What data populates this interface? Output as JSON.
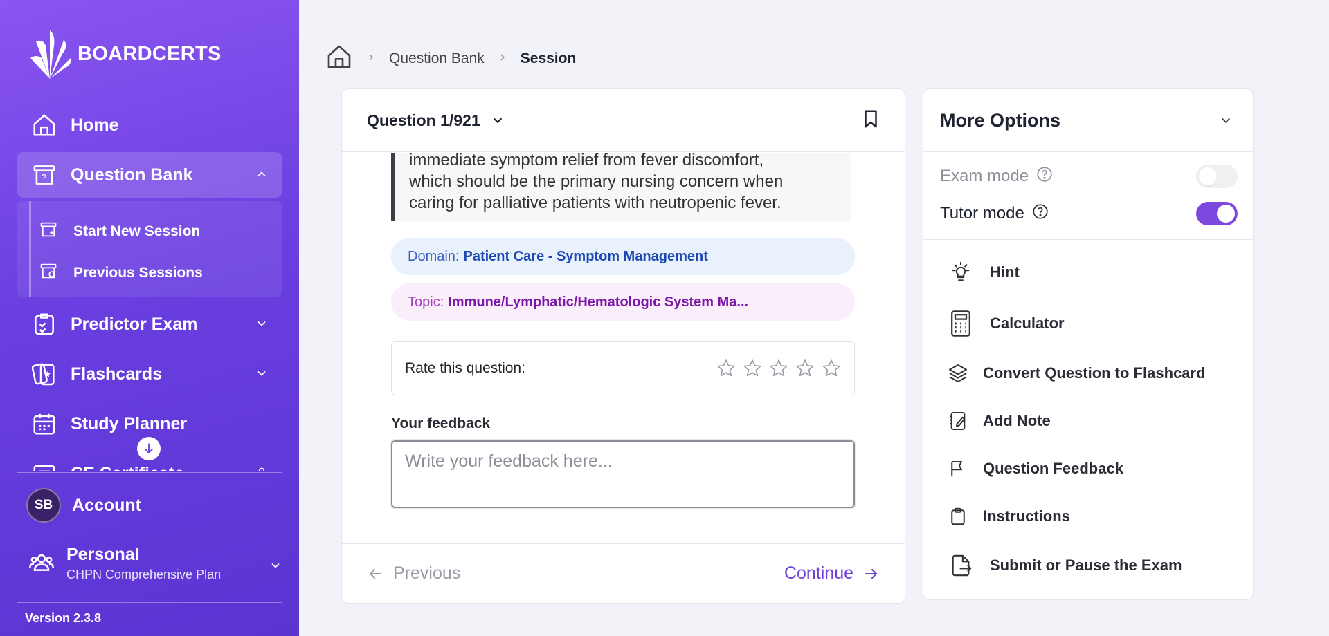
{
  "brand": {
    "name": "BOARDCERTS"
  },
  "sidebar": {
    "items": [
      {
        "label": "Home",
        "icon": "home-icon"
      },
      {
        "label": "Question Bank",
        "icon": "question-box-icon"
      },
      {
        "label": "Predictor Exam",
        "icon": "clipboard-check-icon"
      },
      {
        "label": "Flashcards",
        "icon": "flashcards-icon"
      },
      {
        "label": "Study Planner",
        "icon": "calendar-icon"
      },
      {
        "label": "CE Certificate",
        "icon": "certificate-icon"
      }
    ],
    "subitems": [
      {
        "label": "Start New Session",
        "icon": "new-session-icon"
      },
      {
        "label": "Previous Sessions",
        "icon": "previous-sessions-icon"
      }
    ],
    "account": {
      "initials": "SB",
      "label": "Account"
    },
    "plan": {
      "title": "Personal",
      "subtitle": "CHPN Comprehensive Plan"
    },
    "version": "Version 2.3.8"
  },
  "breadcrumb": {
    "items": [
      "Question Bank",
      "Session"
    ]
  },
  "question": {
    "counter": "Question 1/921",
    "explanation": [
      "immediate symptom relief from fever discomfort,",
      "which should be the primary nursing concern when",
      "caring for palliative patients with neutropenic fever."
    ],
    "domain": {
      "key": "Domain:",
      "value": "Patient Care - Symptom Management"
    },
    "topic": {
      "key": "Topic:",
      "value": "Immune/Lymphatic/Hematologic System Ma..."
    },
    "rate_label": "Rate this question:",
    "rating": 0,
    "rating_max": 5,
    "feedback_label": "Your feedback",
    "feedback_placeholder": "Write your feedback here...",
    "prev_label": "Previous",
    "next_label": "Continue"
  },
  "options": {
    "title": "More Options",
    "exam_mode": {
      "label": "Exam mode",
      "on": false
    },
    "tutor_mode": {
      "label": "Tutor mode",
      "on": true
    },
    "items": [
      {
        "label": "Hint",
        "icon": "lightbulb-icon"
      },
      {
        "label": "Calculator",
        "icon": "calculator-icon"
      },
      {
        "label": "Convert Question to Flashcard",
        "icon": "layers-icon"
      },
      {
        "label": "Add Note",
        "icon": "note-icon"
      },
      {
        "label": "Question Feedback",
        "icon": "flag-icon"
      },
      {
        "label": "Instructions",
        "icon": "clipboard-icon"
      },
      {
        "label": "Submit or Pause the Exam",
        "icon": "file-export-icon"
      }
    ]
  },
  "colors": {
    "sidebar_start": "#8a55f0",
    "sidebar_end": "#5a35d2",
    "accent": "#6b3fd8",
    "toggle_on": "#7d48e0"
  }
}
